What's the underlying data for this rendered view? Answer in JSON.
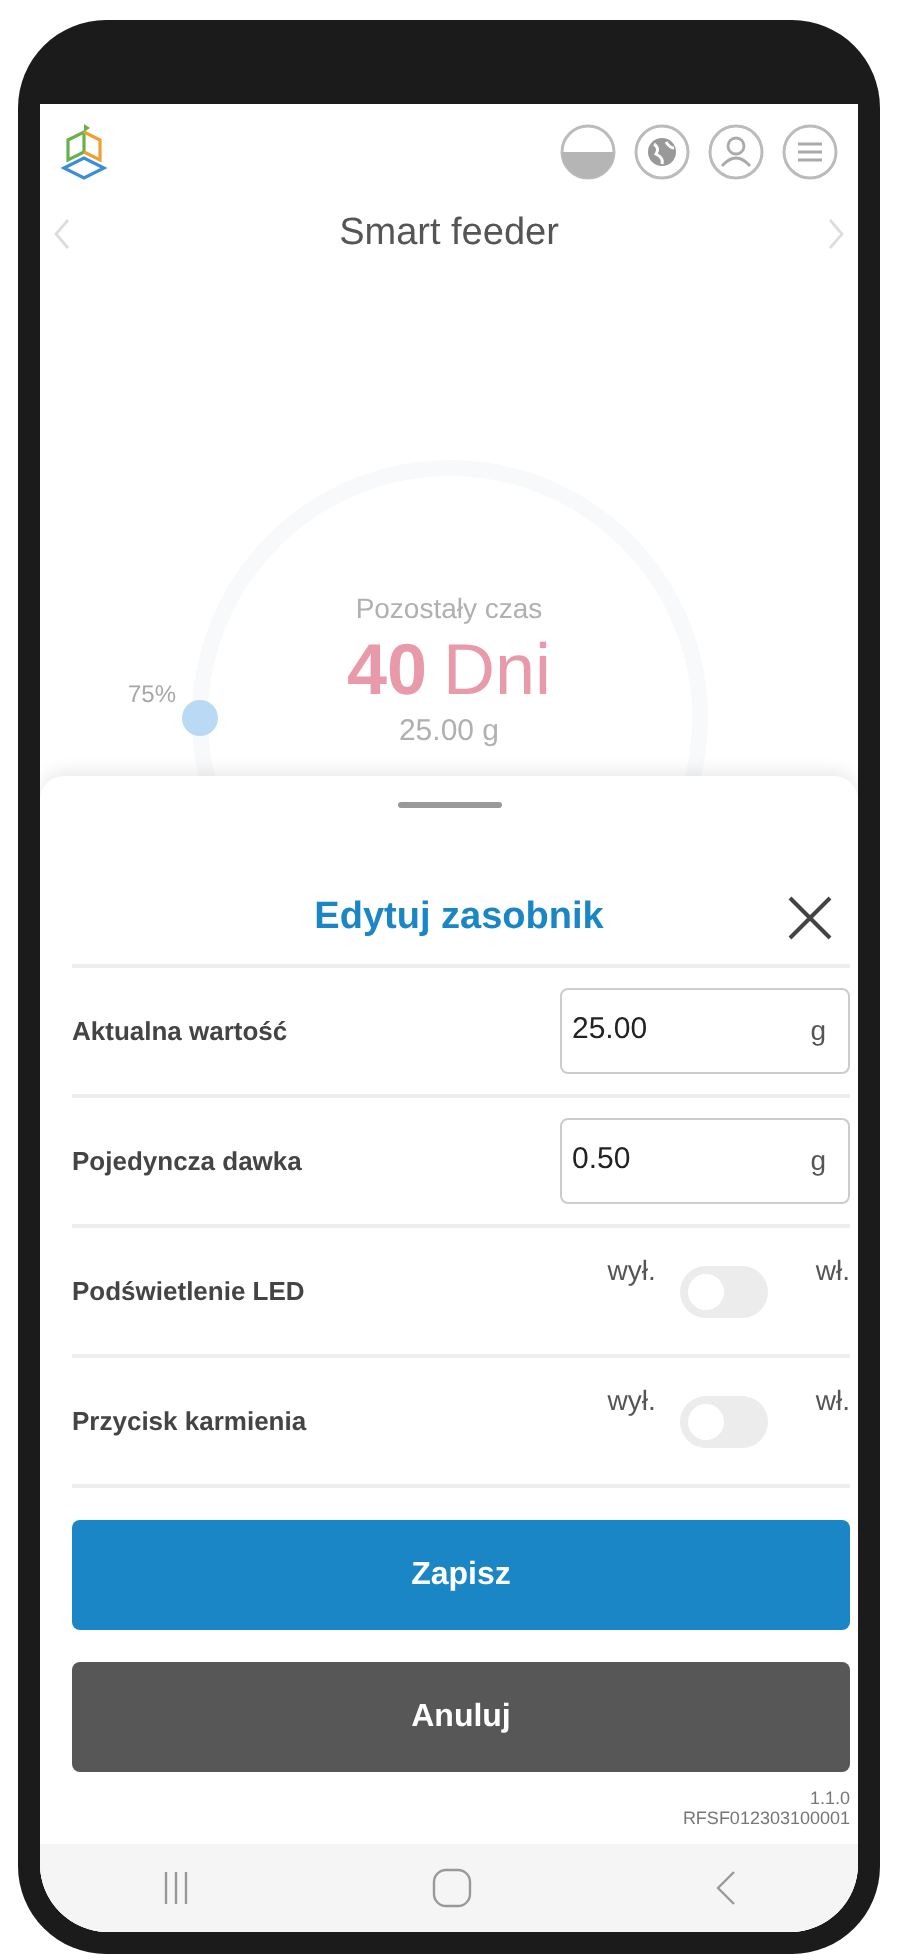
{
  "header": {
    "title": "Smart feeder"
  },
  "gauge": {
    "caption": "Pozostały czas",
    "value": "40",
    "unit": "Dni",
    "percent": "75%",
    "amount": "25.00 g"
  },
  "sheet": {
    "title": "Edytuj zasobnik",
    "fields": [
      {
        "label": "Aktualna wartość",
        "value": "25.00",
        "unit": "g"
      },
      {
        "label": "Pojedyncza dawka",
        "value": "0.50",
        "unit": "g"
      }
    ],
    "switches": [
      {
        "label": "Podświetlenie LED",
        "off_label": "wył.",
        "on_label": "wł.",
        "on": false
      },
      {
        "label": "Przycisk karmienia",
        "off_label": "wył.",
        "on_label": "wł.",
        "on": false
      }
    ],
    "buttons": [
      {
        "label": "Zapisz",
        "kind": "primary"
      },
      {
        "label": "Anuluj",
        "kind": "secondary"
      }
    ],
    "version": "1.1.0",
    "serial": "RFSF012303100001"
  }
}
